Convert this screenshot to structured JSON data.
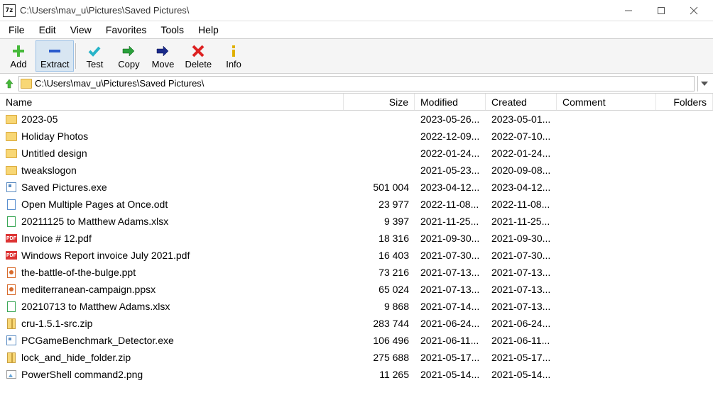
{
  "window": {
    "title": "C:\\Users\\mav_u\\Pictures\\Saved Pictures\\",
    "app_glyph": "7z"
  },
  "menu": {
    "file": "File",
    "edit": "Edit",
    "view": "View",
    "favorites": "Favorites",
    "tools": "Tools",
    "help": "Help"
  },
  "toolbar": {
    "add": "Add",
    "extract": "Extract",
    "test": "Test",
    "copy": "Copy",
    "move": "Move",
    "delete": "Delete",
    "info": "Info"
  },
  "address": {
    "path": "C:\\Users\\mav_u\\Pictures\\Saved Pictures\\"
  },
  "columns": {
    "name": "Name",
    "size": "Size",
    "modified": "Modified",
    "created": "Created",
    "comment": "Comment",
    "folders": "Folders"
  },
  "rows": [
    {
      "icon": "folder",
      "name": "2023-05",
      "size": "",
      "modified": "2023-05-26...",
      "created": "2023-05-01..."
    },
    {
      "icon": "folder",
      "name": "Holiday Photos",
      "size": "",
      "modified": "2022-12-09...",
      "created": "2022-07-10..."
    },
    {
      "icon": "folder",
      "name": "Untitled design",
      "size": "",
      "modified": "2022-01-24...",
      "created": "2022-01-24..."
    },
    {
      "icon": "folder",
      "name": "tweakslogon",
      "size": "",
      "modified": "2021-05-23...",
      "created": "2020-09-08..."
    },
    {
      "icon": "exe",
      "name": "Saved Pictures.exe",
      "size": "501 004",
      "modified": "2023-04-12...",
      "created": "2023-04-12..."
    },
    {
      "icon": "odt",
      "name": "Open Multiple Pages at Once.odt",
      "size": "23 977",
      "modified": "2022-11-08...",
      "created": "2022-11-08..."
    },
    {
      "icon": "xlsx",
      "name": "20211125 to Matthew Adams.xlsx",
      "size": "9 397",
      "modified": "2021-11-25...",
      "created": "2021-11-25..."
    },
    {
      "icon": "pdf",
      "name": "Invoice # 12.pdf",
      "size": "18 316",
      "modified": "2021-09-30...",
      "created": "2021-09-30..."
    },
    {
      "icon": "pdf",
      "name": "Windows Report invoice July 2021.pdf",
      "size": "16 403",
      "modified": "2021-07-30...",
      "created": "2021-07-30..."
    },
    {
      "icon": "ppt",
      "name": "the-battle-of-the-bulge.ppt",
      "size": "73 216",
      "modified": "2021-07-13...",
      "created": "2021-07-13..."
    },
    {
      "icon": "ppt",
      "name": "mediterranean-campaign.ppsx",
      "size": "65 024",
      "modified": "2021-07-13...",
      "created": "2021-07-13..."
    },
    {
      "icon": "xlsx",
      "name": "20210713 to Matthew Adams.xlsx",
      "size": "9 868",
      "modified": "2021-07-14...",
      "created": "2021-07-13..."
    },
    {
      "icon": "zip",
      "name": "cru-1.5.1-src.zip",
      "size": "283 744",
      "modified": "2021-06-24...",
      "created": "2021-06-24..."
    },
    {
      "icon": "exe",
      "name": "PCGameBenchmark_Detector.exe",
      "size": "106 496",
      "modified": "2021-06-11...",
      "created": "2021-06-11..."
    },
    {
      "icon": "zip",
      "name": "lock_and_hide_folder.zip",
      "size": "275 688",
      "modified": "2021-05-17...",
      "created": "2021-05-17..."
    },
    {
      "icon": "png",
      "name": "PowerShell command2.png",
      "size": "11 265",
      "modified": "2021-05-14...",
      "created": "2021-05-14..."
    }
  ]
}
